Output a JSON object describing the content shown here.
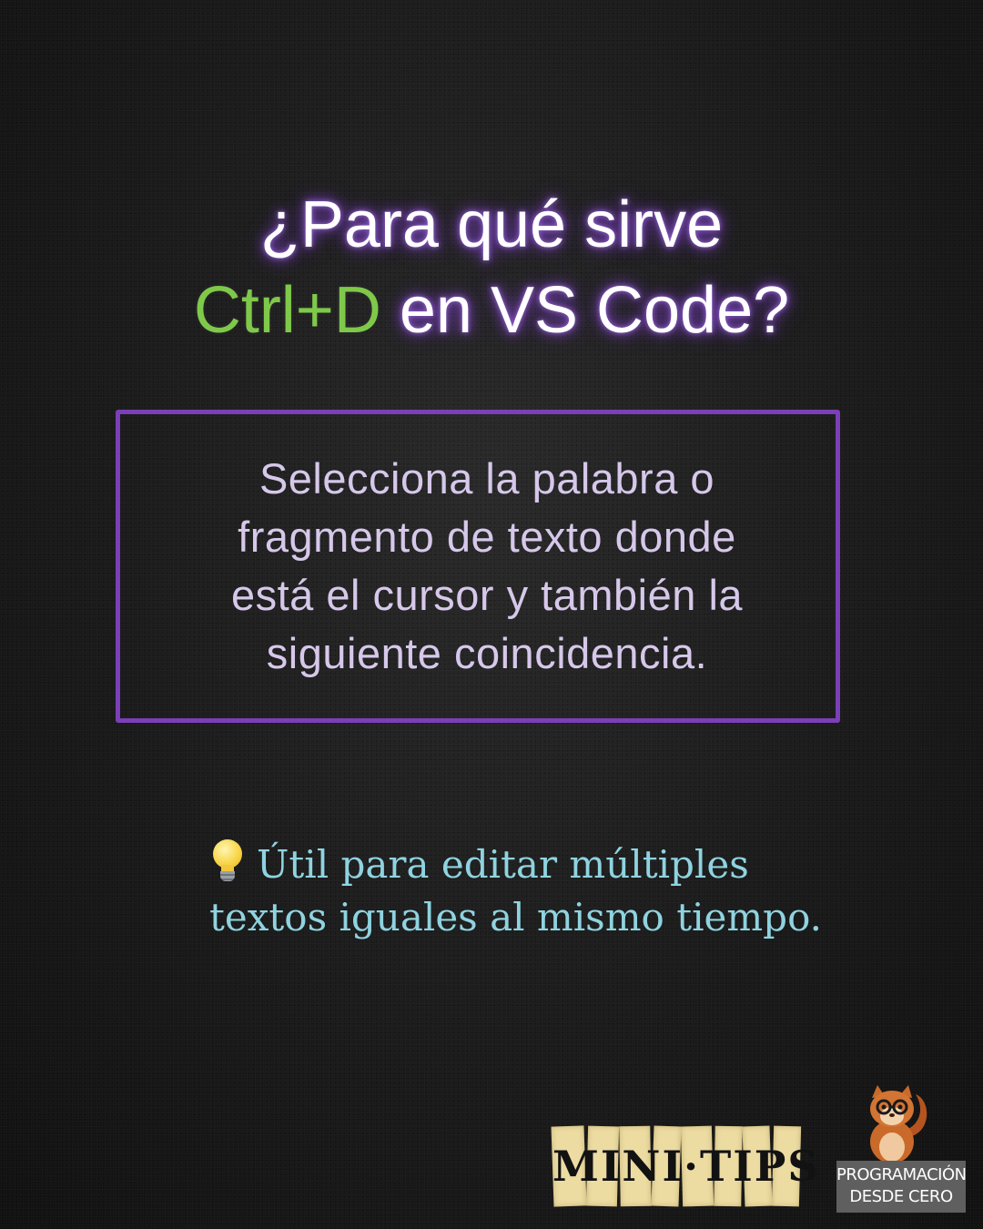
{
  "title": {
    "line1": "¿Para qué sirve",
    "shortcut": "Ctrl+D",
    "line2_rest": " en VS Code?"
  },
  "description": {
    "lines": [
      "Selecciona la palabra o",
      "fragmento de texto donde",
      "está el cursor y también la",
      "siguiente coincidencia."
    ]
  },
  "tip": {
    "icon": "lightbulb-icon",
    "line1": "Útil para editar múltiples",
    "line2": "textos iguales al mismo tiempo."
  },
  "badge": {
    "label": "MINI·TIPS"
  },
  "brand": {
    "line1": "PROGRAMACIÓN",
    "line2": "DESDE CERO"
  },
  "colors": {
    "accent_green": "#7fc94a",
    "accent_purple": "#7b3fb8",
    "tip_cyan": "#8fd3e0"
  }
}
